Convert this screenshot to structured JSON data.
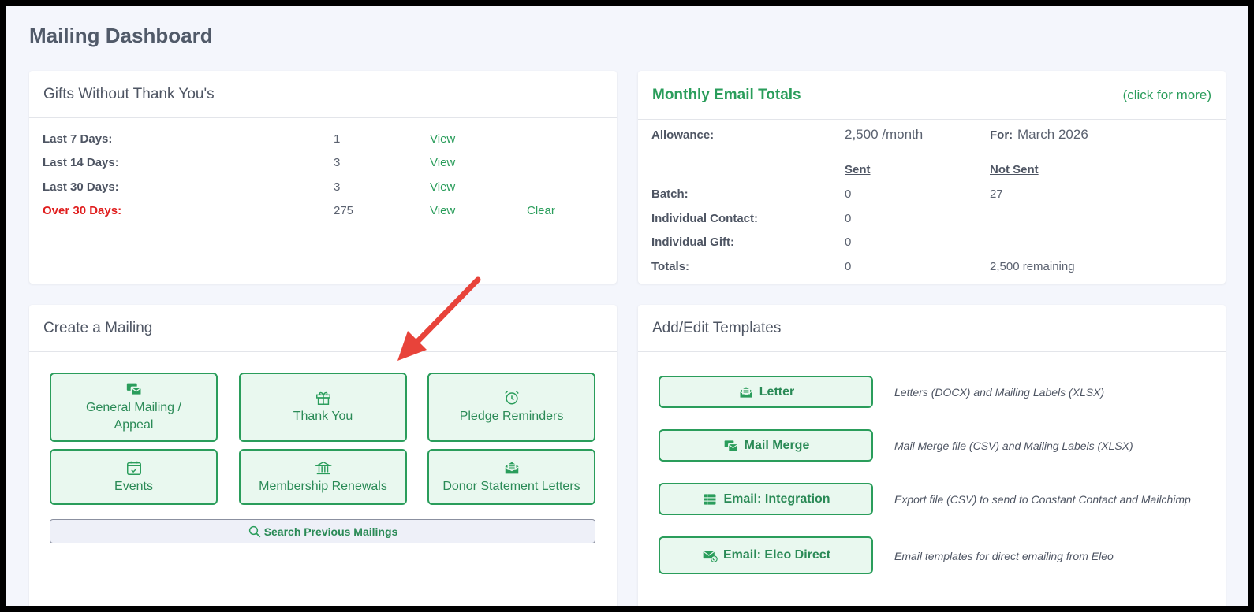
{
  "page": {
    "title": "Mailing Dashboard"
  },
  "gifts": {
    "title": "Gifts Without Thank You's",
    "rows": [
      {
        "label": "Last 7 Days:",
        "count": "1",
        "view": "View"
      },
      {
        "label": "Last 14 Days:",
        "count": "3",
        "view": "View"
      },
      {
        "label": "Last 30 Days:",
        "count": "3",
        "view": "View"
      },
      {
        "label": "Over 30 Days:",
        "count": "275",
        "view": "View",
        "clear": "Clear"
      }
    ]
  },
  "email_totals": {
    "title": "Monthly Email Totals",
    "more_link": "(click for more)",
    "allowance_label": "Allowance:",
    "allowance_value": "2,500 /month",
    "for_label": "For:",
    "for_value": "March 2026",
    "col_sent": "Sent",
    "col_not_sent": "Not Sent",
    "rows": [
      {
        "label": "Batch:",
        "sent": "0",
        "not_sent": "27"
      },
      {
        "label": "Individual Contact:",
        "sent": "0",
        "not_sent": ""
      },
      {
        "label": "Individual Gift:",
        "sent": "0",
        "not_sent": ""
      },
      {
        "label": "Totals:",
        "sent": "0",
        "not_sent": "2,500 remaining"
      }
    ]
  },
  "create_mailing": {
    "title": "Create a Mailing",
    "buttons": [
      {
        "label": "General Mailing / Appeal",
        "icon": "mail-stack-icon"
      },
      {
        "label": "Thank You",
        "icon": "gift-icon"
      },
      {
        "label": "Pledge Reminders",
        "icon": "alarm-clock-icon"
      },
      {
        "label": "Events",
        "icon": "calendar-check-icon"
      },
      {
        "label": "Membership Renewals",
        "icon": "bank-icon"
      },
      {
        "label": "Donor Statement Letters",
        "icon": "envelope-open-icon"
      }
    ],
    "search_label": "Search Previous Mailings"
  },
  "templates": {
    "title": "Add/Edit Templates",
    "items": [
      {
        "label": "Letter",
        "icon": "envelope-open-icon",
        "description": "Letters (DOCX) and Mailing Labels (XLSX)"
      },
      {
        "label": "Mail Merge",
        "icon": "mail-stack-icon",
        "description": "Mail Merge file (CSV) and Mailing Labels (XLSX)"
      },
      {
        "label": "Email: Integration",
        "icon": "list-table-icon",
        "description": "Export file (CSV) to send to Constant Contact and Mailchimp"
      },
      {
        "label": "Email: Eleo Direct",
        "icon": "envelope-at-icon",
        "description": "Email templates for direct emailing from Eleo"
      }
    ]
  },
  "colors": {
    "accent": "#2a9d5b",
    "warning": "#e01d1d",
    "arrow": "#e8433a"
  }
}
